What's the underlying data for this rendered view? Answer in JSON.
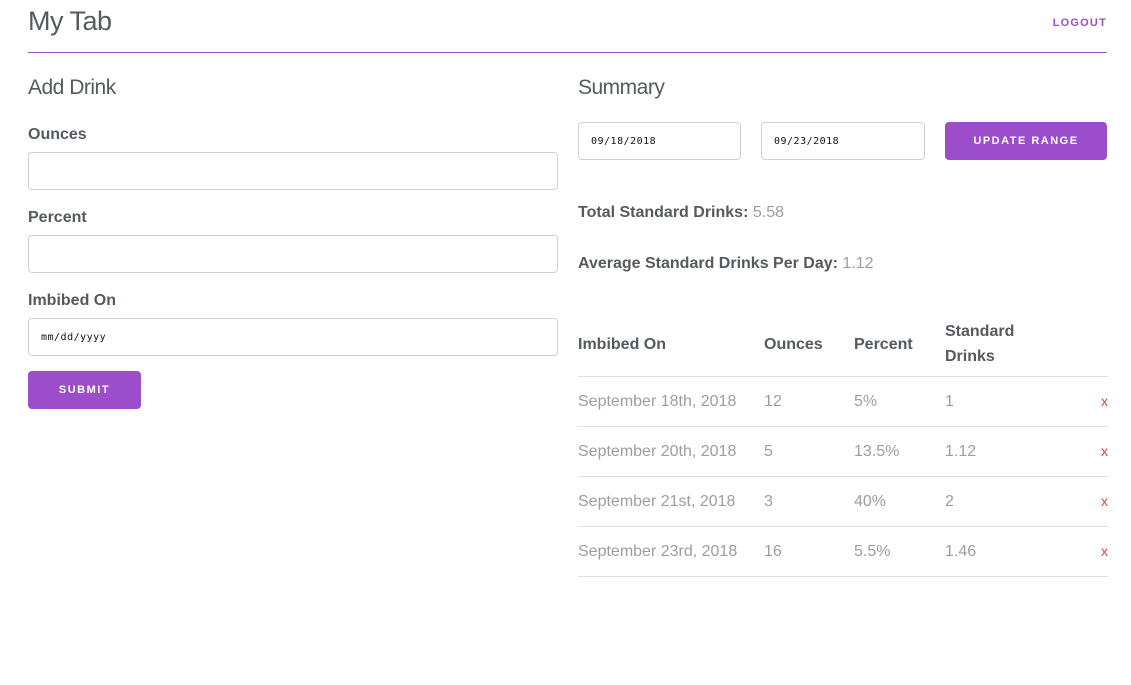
{
  "header": {
    "title": "My Tab",
    "logout_label": "LOGOUT"
  },
  "add_drink": {
    "title": "Add Drink",
    "ounces_label": "Ounces",
    "ounces_value": "",
    "percent_label": "Percent",
    "percent_value": "",
    "imbibed_label": "Imbibed On",
    "imbibed_placeholder": "mm/dd/yyyy",
    "submit_label": "SUBMIT"
  },
  "summary": {
    "title": "Summary",
    "start_date": "09/18/2018",
    "end_date": "09/23/2018",
    "update_label": "UPDATE RANGE",
    "total_label": "Total Standard Drinks:",
    "total_value": "5.58",
    "average_label": "Average Standard Drinks Per Day:",
    "average_value": "1.12"
  },
  "table": {
    "headers": [
      "Imbibed On",
      "Ounces",
      "Percent",
      "Standard Drinks"
    ],
    "delete_label": "x",
    "rows": [
      {
        "date": "September 18th, 2018",
        "ounces": "12",
        "percent": "5%",
        "standard": "1"
      },
      {
        "date": "September 20th, 2018",
        "ounces": "5",
        "percent": "13.5%",
        "standard": "1.12"
      },
      {
        "date": "September 21st, 2018",
        "ounces": "3",
        "percent": "40%",
        "standard": "2"
      },
      {
        "date": "September 23rd, 2018",
        "ounces": "16",
        "percent": "5.5%",
        "standard": "1.46"
      }
    ]
  },
  "colors": {
    "accent": "#9b4dca",
    "delete": "#e0443b",
    "text": "#555a60",
    "muted": "#9a9ea3"
  }
}
